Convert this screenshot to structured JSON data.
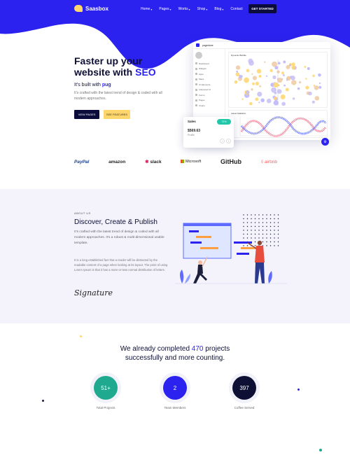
{
  "nav": {
    "brand": "Saasbox",
    "items": [
      {
        "label": "Home",
        "caret": "▾"
      },
      {
        "label": "Pages",
        "caret": "▾"
      },
      {
        "label": "Works",
        "caret": "▾"
      },
      {
        "label": "Shop",
        "caret": "▾"
      },
      {
        "label": "Blog",
        "caret": "▾"
      },
      {
        "label": "Contact",
        "caret": ""
      }
    ],
    "cta": "GET STARTED"
  },
  "hero": {
    "title_main": "Faster up your website with ",
    "title_accent": "SEO",
    "sub_prefix": "It's built with ",
    "sub_accent": "pug",
    "description": "It's crafted with the latest trend of design & coded with all modern approaches.",
    "btn_primary": "VIEW PAGES",
    "btn_secondary": "SEE FEATURES"
  },
  "dashboard": {
    "brand": "pagedone",
    "sidebar_items": [
      "Dashboard",
      "Widgets",
      "Apps",
      "Maps",
      "UI Elements",
      "Advanced UI",
      "Forms",
      "Pages",
      "Charts"
    ],
    "panel_1_title": "Dynamic Bubble",
    "panel_2_title": "Latest Statistics",
    "sales": {
      "label": "Sales",
      "value": "$569.63",
      "note": "Profile",
      "pill": "72%"
    }
  },
  "brands": [
    "PayPal",
    "amazon",
    "slack",
    "Microsoft",
    "GitHub",
    "airbnb"
  ],
  "about": {
    "label": "ABOUT US",
    "title": "Discover, Create & Publish",
    "description": "It's crafted with the latest trend of design & coded with all modern approaches. It's a robust & multi-dimensional usable template.",
    "description_2": "It is a long established fact that a reader will be distracted by the readable content of a page when looking at its layout. The point of using Lorem Ipsum is that it has a more-or-less normal distribution of letters.",
    "signature": "Signature"
  },
  "stats": {
    "title_line1_prefix": "We already completed ",
    "title_line1_number": "470",
    "title_line1_suffix": " projects",
    "title_line2": "successfully and more counting.",
    "items": [
      {
        "value": "51+",
        "label": "Total Projects",
        "color": "#1fa98f"
      },
      {
        "value": "2",
        "label": "Team Members",
        "color": "#2b22f0"
      },
      {
        "value": "397",
        "label": "Coffee Served",
        "color": "#0d0f34"
      }
    ]
  },
  "colors": {
    "primary": "#2b22f0",
    "dark": "#0b0c3c",
    "accent": "#ffd66b",
    "about_bg": "#f4f3fc"
  }
}
